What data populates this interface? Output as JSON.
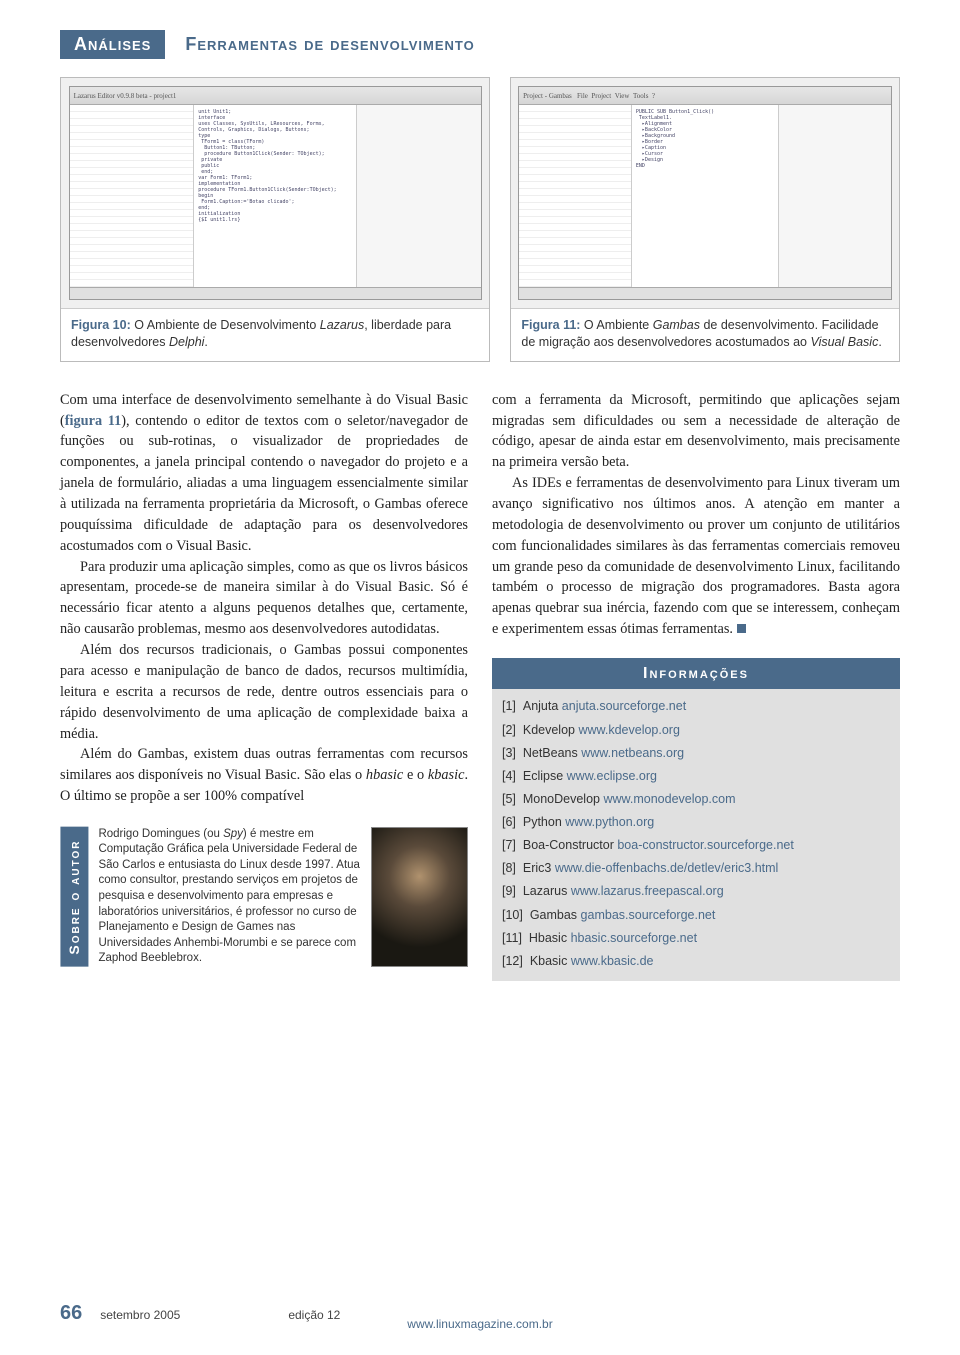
{
  "header": {
    "category": "Análises",
    "title": "Ferramentas de desenvolvimento"
  },
  "figures": {
    "left": {
      "label": "Figura 10:",
      "text_before_em1": " O Ambiente de Desenvolvimento ",
      "em1": "Lazarus",
      "text_mid": ", liberdade para desenvolvedores ",
      "em2": "Delphi",
      "text_after": "."
    },
    "right": {
      "label": "Figura 11:",
      "text_before_em1": " O Ambiente ",
      "em1": "Gambas",
      "text_mid": " de desenvolvimento. Facilidade de migração aos desenvolvedores acostumados ao ",
      "em2": "Visual Basic",
      "text_after": "."
    }
  },
  "body": {
    "p1a": "Com uma interface de desenvolvimento semelhante à do Visual Basic (",
    "p1_figref": "figura 11",
    "p1b": "), contendo o editor de textos com o seletor/navegador de funções ou sub-rotinas, o visualizador de propriedades de componentes, a janela principal contendo o navegador do projeto e a janela de formulário, aliadas a uma linguagem essencialmente similar à utilizada na ferramenta proprietária da Microsoft, o Gambas oferece pouquíssima dificuldade de adaptação para os desenvolvedores acostumados com o Visual Basic.",
    "p2": "Para produzir uma aplicação simples, como as que os livros básicos apresentam, procede-se de maneira similar à do Visual Basic. Só é necessário ficar atento a alguns pequenos detalhes que, certamente, não causarão problemas, mesmo aos desenvolvedores autodidatas.",
    "p3": "Além dos recursos tradicionais, o Gambas possui componentes para acesso e manipulação de banco de dados, recursos multimídia, leitura e escrita a recursos de rede, dentre outros essenciais para o rápido desenvolvimento de uma aplicação de complexidade baixa a média.",
    "p4a": "Além do Gambas, existem duas outras ferramentas com recursos similares aos disponíveis no Visual Basic. São elas o ",
    "p4_em1": "hbasic",
    "p4b": " e o ",
    "p4_em2": "kbasic",
    "p4c": ". O último se propõe a ser 100% compatível",
    "p5": "com a ferramenta da Microsoft, permitindo que aplicações sejam migradas sem dificuldades ou sem a necessidade de alteração de código, apesar de ainda estar em desenvolvimento, mais precisamente na primeira versão beta.",
    "p6": "As IDEs e ferramentas de desenvolvimento para Linux tiveram um avanço significativo nos últimos anos. A atenção em manter a metodologia de desenvolvimento ou prover um conjunto de utilitários com funcionalidades similares às das ferramentas comerciais removeu um grande peso da comunidade de desenvolvimento Linux, facilitando também o processo de migração dos programadores. Basta agora apenas quebrar sua inércia, fazendo com que se interessem, conheçam e experimentem essas ótimas ferramentas."
  },
  "author": {
    "tab": "Sobre o autor",
    "text_a": "Rodrigo Domingues (ou ",
    "text_em": "Spy",
    "text_b": ") é mestre em Computação Gráfica pela Universidade Federal de São Carlos e entusiasta do Linux desde 1997. Atua como consultor, prestando serviços em projetos de pesquisa e desenvolvimento para empresas e laboratórios universitários, é professor no curso de Planejamento e Design de Games nas Universidades Anhembi-Morumbi e se parece com Zaphod Beeblebrox."
  },
  "info": {
    "header": "Informações",
    "items": [
      {
        "idx": "[1]",
        "name": "Anjuta",
        "url": "anjuta.sourceforge.net"
      },
      {
        "idx": "[2]",
        "name": "Kdevelop",
        "url": "www.kdevelop.org"
      },
      {
        "idx": "[3]",
        "name": "NetBeans",
        "url": "www.netbeans.org"
      },
      {
        "idx": "[4]",
        "name": "Eclipse",
        "url": "www.eclipse.org"
      },
      {
        "idx": "[5]",
        "name": "MonoDevelop",
        "url": "www.monodevelop.com"
      },
      {
        "idx": "[6]",
        "name": "Python",
        "url": "www.python.org"
      },
      {
        "idx": "[7]",
        "name": "Boa-Constructor",
        "url": "boa-constructor.sourceforge.net"
      },
      {
        "idx": "[8]",
        "name": "Eric3",
        "url": "www.die-offenbachs.de/detlev/eric3.html"
      },
      {
        "idx": "[9]",
        "name": "Lazarus",
        "url": "www.lazarus.freepascal.org"
      },
      {
        "idx": "[10]",
        "name": "Gambas",
        "url": "gambas.sourceforge.net"
      },
      {
        "idx": "[11]",
        "name": "Hbasic",
        "url": "hbasic.sourceforge.net"
      },
      {
        "idx": "[12]",
        "name": "Kbasic",
        "url": "www.kbasic.de"
      }
    ]
  },
  "footer": {
    "page_num": "66",
    "month": "setembro 2005",
    "edition": "edição 12",
    "url": "www.linuxmagazine.com.br"
  }
}
